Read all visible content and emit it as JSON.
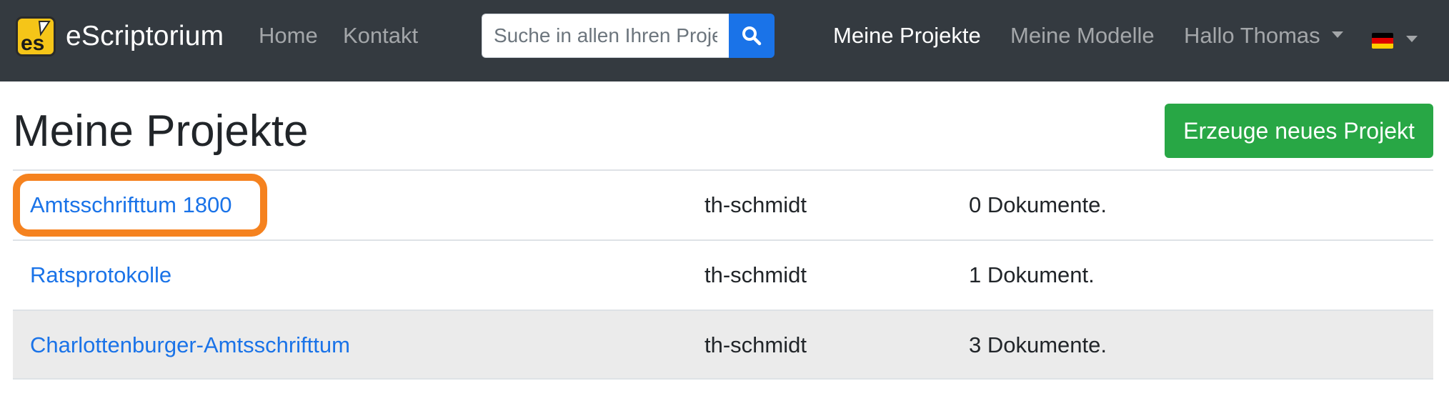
{
  "navbar": {
    "brand": "eScriptorium",
    "home": "Home",
    "contact": "Kontakt",
    "search_placeholder": "Suche in allen Ihren Projekten",
    "my_projects": "Meine Projekte",
    "my_models": "Meine Modelle",
    "user_menu": "Hallo Thomas",
    "language": "de"
  },
  "page": {
    "title": "Meine Projekte",
    "new_project_button": "Erzeuge neues Projekt"
  },
  "projects": [
    {
      "name": "Amtsschrifttum 1800",
      "owner": "th-schmidt",
      "documents": "0 Dokumente.",
      "highlighted": true
    },
    {
      "name": "Ratsprotokolle",
      "owner": "th-schmidt",
      "documents": "1 Dokument."
    },
    {
      "name": "Charlottenburger-Amtsschrifttum",
      "owner": "th-schmidt",
      "documents": "3 Dokumente."
    }
  ],
  "colors": {
    "navbar": "#343a40",
    "link": "#1a73e8",
    "primary_button": "#1a73e8",
    "success_button": "#28a745",
    "highlight": "#f5821f"
  }
}
